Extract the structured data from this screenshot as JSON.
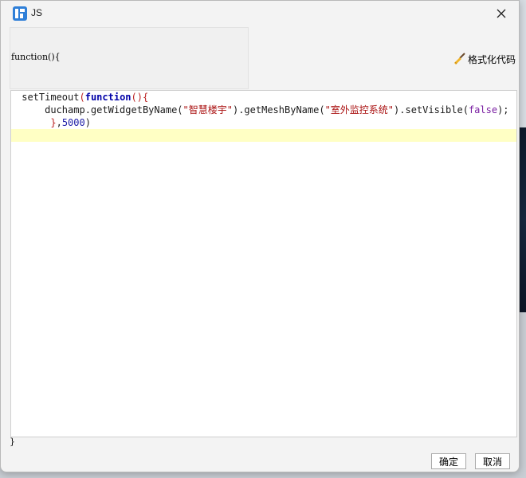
{
  "window": {
    "title": "JS"
  },
  "header": {
    "signature": "function(){"
  },
  "toolbar": {
    "format_label": "格式化代码"
  },
  "editor": {
    "lines": [
      {
        "indent": " ",
        "tokens": [
          {
            "t": "setTimeout",
            "c": "plain"
          },
          {
            "t": "(",
            "c": "paren"
          },
          {
            "t": "function",
            "c": "kw"
          },
          {
            "t": "(){",
            "c": "paren"
          }
        ]
      },
      {
        "indent": "     ",
        "tokens": [
          {
            "t": "duchamp.getWidgetByName(",
            "c": "plain"
          },
          {
            "t": "\"智慧楼宇\"",
            "c": "str"
          },
          {
            "t": ").getMeshByName(",
            "c": "plain"
          },
          {
            "t": "\"室外监控系统\"",
            "c": "str"
          },
          {
            "t": ").setVisible(",
            "c": "plain"
          },
          {
            "t": "false",
            "c": "bool"
          },
          {
            "t": ");",
            "c": "plain"
          }
        ]
      },
      {
        "indent": "      ",
        "tokens": [
          {
            "t": "}",
            "c": "paren"
          },
          {
            "t": ",",
            "c": "plain"
          },
          {
            "t": "5000",
            "c": "num"
          },
          {
            "t": ")",
            "c": "plain"
          }
        ]
      }
    ]
  },
  "footer": {
    "closing": "}"
  },
  "actions": {
    "ok_label": "确定",
    "cancel_label": "取消"
  },
  "colors": {
    "accent": "#2f7fd8",
    "active_line": "#ffffc4",
    "keyword": "#0000a8",
    "string": "#aa1111"
  },
  "icons": {
    "app": "app-logo-icon",
    "close": "close-icon",
    "format": "broom-icon"
  }
}
